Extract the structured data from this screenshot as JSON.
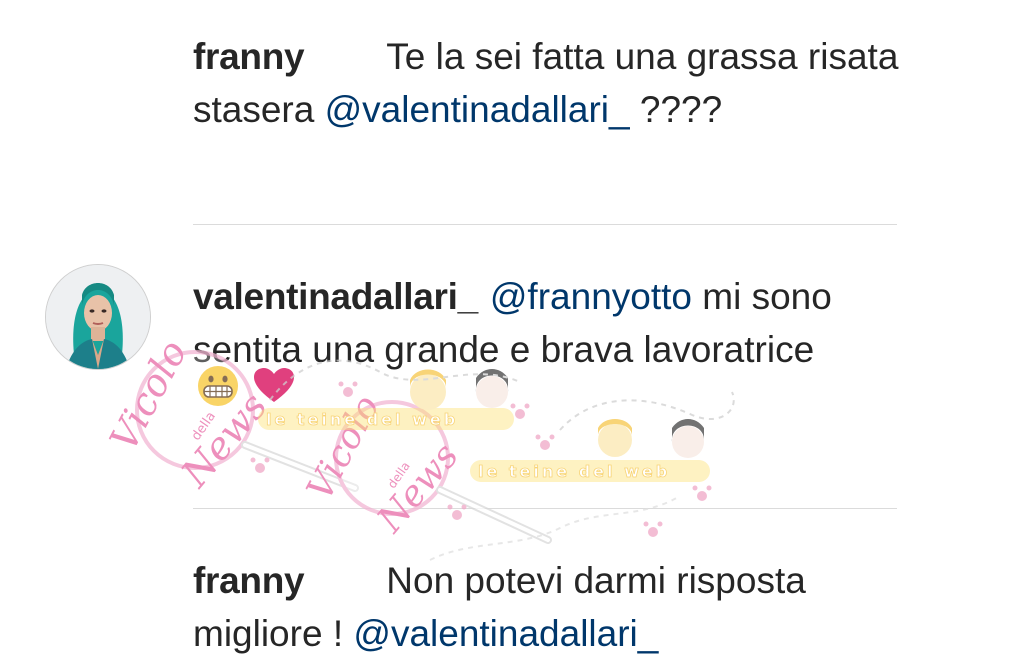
{
  "comments": [
    {
      "username": "franny",
      "text_before": "Te la sei fatta una grassa risata stasera ",
      "mention": "@valentinadallari_",
      "text_after": " ????"
    },
    {
      "username": "valentinadallari_",
      "mention": "@frannyotto",
      "text_after": " mi sono sentita una grande e brava lavoratrice",
      "emojis": [
        "grimacing-face-emoji",
        "pink-heart-emoji"
      ]
    },
    {
      "username": "franny",
      "text_before": "Non potevi darmi risposta migliore ! ",
      "mention": "@valentinadallari_"
    }
  ],
  "watermark": {
    "logo_text": "Vicolo della News",
    "tagline": "le teine del web"
  },
  "colors": {
    "text": "#262626",
    "mention": "#00376b",
    "divider": "#dbdbdb",
    "watermark_pink": "#e86aa6",
    "heart": "#e0407e"
  }
}
